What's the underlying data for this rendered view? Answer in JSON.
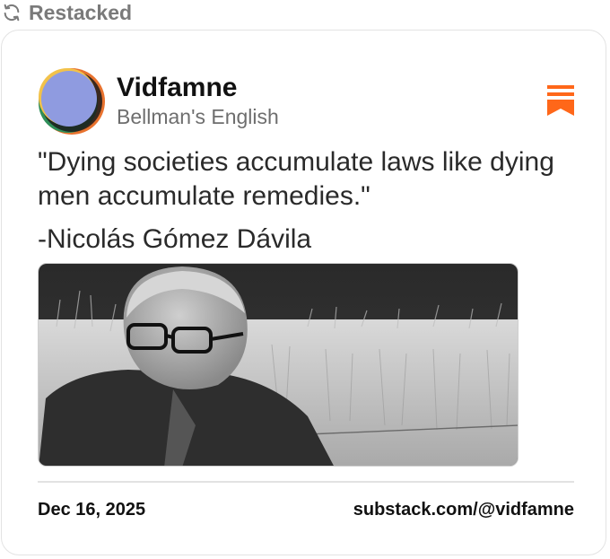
{
  "restack": {
    "label": "Restacked",
    "icon": "restack-arrows-icon"
  },
  "note": {
    "author": "Vidfamne",
    "publication": "Bellman's English",
    "quote_line": "\"Dying societies accumulate laws like dying men accumulate remedies.\"",
    "attribution": "-Nicolás Gómez Dávila",
    "image_description_icon": "portrait-photo",
    "date": "Dec 16, 2025",
    "handle": "substack.com/@vidfamne"
  },
  "colors": {
    "brand_orange": "#FF6719",
    "muted_text": "#7a7a7a",
    "avatar_blue": "#8f9be0",
    "avatar_green": "#2f8f5a",
    "avatar_yellow": "#f2c24a",
    "avatar_orange": "#e8722e"
  }
}
